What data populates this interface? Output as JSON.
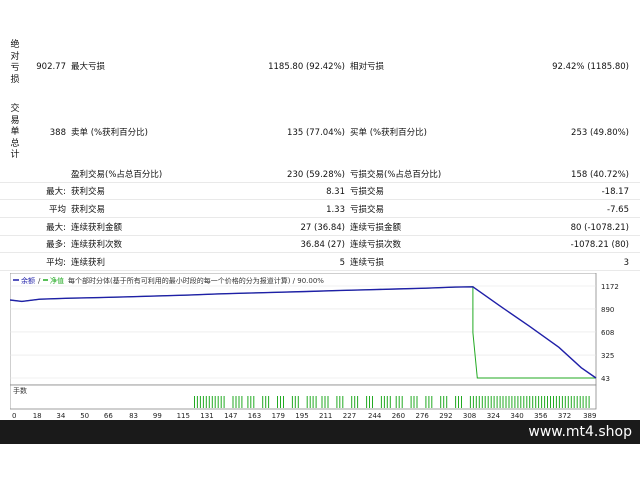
{
  "report": {
    "section_absolute_drawdown": "绝对亏损",
    "section_trade_summary": "交易单总计",
    "rows": [
      {
        "v0": "902.77",
        "l1": "最大亏损",
        "v1": "1185.80 (92.42%)",
        "l2": "相对亏损",
        "v2": "92.42% (1185.80)"
      },
      {
        "v0": "388",
        "l1": "卖单 (%获利百分比)",
        "v1": "135 (77.04%)",
        "l2": "买单 (%获利百分比)",
        "v2": "253 (49.80%)"
      },
      {
        "v0": "",
        "l1": "盈利交易(%占总百分比)",
        "v1": "230 (59.28%)",
        "l2": "亏损交易(%占总百分比)",
        "v2": "158 (40.72%)"
      },
      {
        "v0": "最大:",
        "l1": "获利交易",
        "v1": "8.31",
        "l2": "亏损交易",
        "v2": "-18.17"
      },
      {
        "v0": "平均",
        "l1": "获利交易",
        "v1": "1.33",
        "l2": "亏损交易",
        "v2": "-7.65"
      },
      {
        "v0": "最大:",
        "l1": "连续获利金额",
        "v1": "27 (36.84)",
        "l2": "连续亏损金额",
        "v2": "80 (-1078.21)"
      },
      {
        "v0": "最多:",
        "l1": "连续获利次数",
        "v1": "36.84 (27)",
        "l2": "连续亏损次数",
        "v2": "-1078.21 (80)"
      },
      {
        "v0": "平均:",
        "l1": "连续获利",
        "v1": "5",
        "l2": "连续亏损",
        "v2": "3"
      }
    ]
  },
  "chart": {
    "header_balance": "余额",
    "header_equity": "净值",
    "header_note": "每个部时分体(基于所有可利用的最小时段的每一个价格的分为报道计算) / 90.00%",
    "volume_label": "手数",
    "balance_color": "#1f1fa8",
    "equity_color": "#22aa22",
    "y_ticks": [
      "1172",
      "890",
      "608",
      "325",
      "43"
    ],
    "x_ticks": [
      "0",
      "18",
      "34",
      "50",
      "66",
      "83",
      "99",
      "115",
      "131",
      "147",
      "163",
      "179",
      "195",
      "211",
      "227",
      "244",
      "260",
      "276",
      "292",
      "308",
      "324",
      "340",
      "356",
      "372",
      "389"
    ]
  },
  "chart_data": {
    "type": "line",
    "ylim": [
      43,
      1172
    ],
    "xlim": [
      0,
      395
    ],
    "series": [
      {
        "name": "余额",
        "points": [
          [
            0,
            1000
          ],
          [
            8,
            983
          ],
          [
            20,
            1010
          ],
          [
            40,
            1022
          ],
          [
            60,
            1030
          ],
          [
            80,
            1040
          ],
          [
            100,
            1050
          ],
          [
            120,
            1060
          ],
          [
            140,
            1075
          ],
          [
            160,
            1085
          ],
          [
            180,
            1095
          ],
          [
            200,
            1105
          ],
          [
            220,
            1115
          ],
          [
            240,
            1125
          ],
          [
            260,
            1135
          ],
          [
            280,
            1145
          ],
          [
            300,
            1158
          ],
          [
            312,
            1162
          ],
          [
            330,
            930
          ],
          [
            350,
            680
          ],
          [
            370,
            420
          ],
          [
            385,
            170
          ],
          [
            395,
            43
          ]
        ]
      },
      {
        "name": "净值",
        "points": [
          [
            0,
            1000
          ],
          [
            8,
            983
          ],
          [
            20,
            1010
          ],
          [
            40,
            1022
          ],
          [
            60,
            1030
          ],
          [
            80,
            1040
          ],
          [
            100,
            1050
          ],
          [
            120,
            1060
          ],
          [
            140,
            1075
          ],
          [
            160,
            1085
          ],
          [
            180,
            1095
          ],
          [
            200,
            1105
          ],
          [
            220,
            1115
          ],
          [
            240,
            1125
          ],
          [
            260,
            1135
          ],
          [
            280,
            1145
          ],
          [
            300,
            1158
          ],
          [
            312,
            1162
          ],
          [
            312,
            600
          ],
          [
            312,
            600
          ],
          [
            315,
            43
          ],
          [
            395,
            43
          ]
        ]
      }
    ],
    "volume_bars_x": [
      124,
      126,
      128,
      130,
      132,
      134,
      136,
      138,
      140,
      142,
      144,
      150,
      152,
      154,
      156,
      160,
      162,
      164,
      170,
      172,
      174,
      180,
      182,
      184,
      190,
      192,
      194,
      200,
      202,
      204,
      206,
      210,
      212,
      214,
      220,
      222,
      224,
      230,
      232,
      234,
      240,
      242,
      244,
      250,
      252,
      254,
      256,
      260,
      262,
      264,
      270,
      272,
      274,
      280,
      282,
      284,
      290,
      292,
      294,
      300,
      302,
      304,
      310,
      312,
      314,
      316,
      318,
      320,
      322,
      324,
      326,
      328,
      330,
      332,
      334,
      336,
      338,
      340,
      342,
      344,
      346,
      348,
      350,
      352,
      354,
      356,
      358,
      360,
      362,
      364,
      366,
      368,
      370,
      372,
      374,
      376,
      378,
      380,
      382,
      384,
      386,
      388,
      390
    ]
  }
}
